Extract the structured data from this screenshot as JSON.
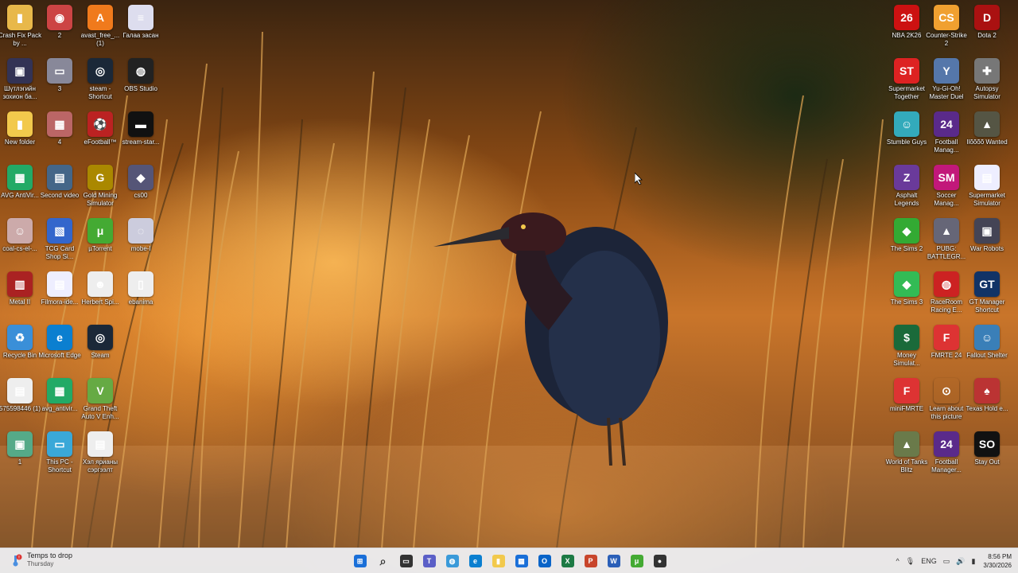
{
  "desktop": {
    "left_icons": [
      {
        "label": "Crash Fix Pack by ...",
        "color": "#e8b84a",
        "glyph": "▮"
      },
      {
        "label": "2",
        "color": "#c44",
        "glyph": "◉"
      },
      {
        "label": "avast_free_... (1)",
        "color": "#f07a1c",
        "glyph": "A"
      },
      {
        "label": "Галаа засан",
        "color": "#dde",
        "glyph": "≡"
      },
      {
        "label": "Шүтлэгийн зохион ба...",
        "color": "#335",
        "glyph": "▣"
      },
      {
        "label": "3",
        "color": "#889",
        "glyph": "▭"
      },
      {
        "label": "steam - Shortcut",
        "color": "#1b2838",
        "glyph": "◎"
      },
      {
        "label": "OBS Studio",
        "color": "#222",
        "glyph": "◍"
      },
      {
        "label": "New folder",
        "color": "#f2c94c",
        "glyph": "▮"
      },
      {
        "label": "4",
        "color": "#b66",
        "glyph": "▦"
      },
      {
        "label": "eFootball™",
        "color": "#b22",
        "glyph": "⚽"
      },
      {
        "label": "stream-star...",
        "color": "#111",
        "glyph": "▬"
      },
      {
        "label": "AVG AntiVir...",
        "color": "#2a6",
        "glyph": "▦"
      },
      {
        "label": "Second video",
        "color": "#468",
        "glyph": "▤"
      },
      {
        "label": "Gold Mining Simulator",
        "color": "#a80",
        "glyph": "G"
      },
      {
        "label": "cs00",
        "color": "#557",
        "glyph": "◆"
      },
      {
        "label": "coal-cs-el-...",
        "color": "#caa",
        "glyph": "☺"
      },
      {
        "label": "TCG Card Shop Si...",
        "color": "#36c",
        "glyph": "▧"
      },
      {
        "label": "µTorrent",
        "color": "#4a3",
        "glyph": "μ"
      },
      {
        "label": "mobe-l",
        "color": "#ccd",
        "glyph": "◌"
      },
      {
        "label": "Metal II",
        "color": "#a22",
        "glyph": "▥"
      },
      {
        "label": "Filmora-ide...",
        "color": "#eef",
        "glyph": "▤"
      },
      {
        "label": "Herbert Spi...",
        "color": "#eee",
        "glyph": "☻"
      },
      {
        "label": "ebanima",
        "color": "#eee",
        "glyph": "▯"
      },
      {
        "label": "Recycle Bin",
        "color": "#3a8fd8",
        "glyph": "♻"
      },
      {
        "label": "Microsoft Edge",
        "color": "#0b7fd0",
        "glyph": "e"
      },
      {
        "label": "Steam",
        "color": "#1b2838",
        "glyph": "◎"
      },
      {
        "label": "575598446 (1)",
        "color": "#eee",
        "glyph": "▤"
      },
      {
        "label": "avg_antivir...",
        "color": "#2a6",
        "glyph": "▦"
      },
      {
        "label": "Grand Theft Auto V Enh...",
        "color": "#6a4",
        "glyph": "V"
      },
      {
        "label": "1",
        "color": "#5a8",
        "glyph": "▣"
      },
      {
        "label": "This PC - Shortcut",
        "color": "#3aa8d8",
        "glyph": "▭"
      },
      {
        "label": "Хэл ярианы сэргээлт",
        "color": "#eee",
        "glyph": "▤"
      }
    ],
    "right_icons": [
      {
        "label": "NBA 2K26",
        "color": "#c11",
        "glyph": "26"
      },
      {
        "label": "Counter-Strike 2",
        "color": "#f0a030",
        "glyph": "CS"
      },
      {
        "label": "Dota 2",
        "color": "#a11",
        "glyph": "D"
      },
      {
        "label": "Supermarket Together",
        "color": "#d22",
        "glyph": "ST"
      },
      {
        "label": "Yu-Gi-Oh! Master Duel",
        "color": "#57a",
        "glyph": "Y"
      },
      {
        "label": "Autopsy Simulator",
        "color": "#777",
        "glyph": "✚"
      },
      {
        "label": "Stumble Guys",
        "color": "#3ab",
        "glyph": "☺"
      },
      {
        "label": "Football Manag...",
        "color": "#5a2a8a",
        "glyph": "24"
      },
      {
        "label": "Ilõõõõ Wanted",
        "color": "#554",
        "glyph": "▲"
      },
      {
        "label": "Asphalt Legends",
        "color": "#6a3a9a",
        "glyph": "Z"
      },
      {
        "label": "Soccer Manag...",
        "color": "#c2187a",
        "glyph": "SM"
      },
      {
        "label": "Supermarket Simulator",
        "color": "#eef",
        "glyph": "▤"
      },
      {
        "label": "The Sims 2",
        "color": "#3a3",
        "glyph": "◆"
      },
      {
        "label": "PUBG: BATTLEGR...",
        "color": "#667",
        "glyph": "▲"
      },
      {
        "label": "War Robots",
        "color": "#445",
        "glyph": "▣"
      },
      {
        "label": "The Sims 3",
        "color": "#3b5",
        "glyph": "◆"
      },
      {
        "label": "RaceRoom Racing E...",
        "color": "#c22",
        "glyph": "◍"
      },
      {
        "label": "GT Manager Shortcut",
        "color": "#136",
        "glyph": "GT"
      },
      {
        "label": "Money Simulat...",
        "color": "#1a6a3a",
        "glyph": "$"
      },
      {
        "label": "FMRTE 24",
        "color": "#d33",
        "glyph": "F"
      },
      {
        "label": "Fallout Shelter",
        "color": "#3a7fb8",
        "glyph": "☺"
      },
      {
        "label": "miniFMRTE",
        "color": "#d33",
        "glyph": "F"
      },
      {
        "label": "Learn about this picture",
        "color": "rgba(0,0,0,0)",
        "glyph": "⊙"
      },
      {
        "label": "Texas Hold e...",
        "color": "#b33",
        "glyph": "♠"
      },
      {
        "label": "World of Tanks Blitz",
        "color": "#6a7a4a",
        "glyph": "▲"
      },
      {
        "label": "Football Manager...",
        "color": "#5a2a8a",
        "glyph": "24"
      },
      {
        "label": "Stay Out",
        "color": "#111",
        "glyph": "SO"
      }
    ]
  },
  "taskbar": {
    "weather_line1": "Temps to drop",
    "weather_line2": "Thursday",
    "apps": [
      {
        "name": "start-button",
        "color": "#1a6fd8",
        "glyph": "⊞"
      },
      {
        "name": "search-button",
        "color": "rgba(0,0,0,0)",
        "glyph": "⌕"
      },
      {
        "name": "task-view-button",
        "color": "#333",
        "glyph": "▭"
      },
      {
        "name": "teams-button",
        "color": "#5b5fc7",
        "glyph": "T"
      },
      {
        "name": "copilot-button",
        "color": "#3a9ad9",
        "glyph": "◍"
      },
      {
        "name": "edge-button",
        "color": "#0b7fd0",
        "glyph": "e"
      },
      {
        "name": "file-explorer-button",
        "color": "#f2c94c",
        "glyph": "▮"
      },
      {
        "name": "store-button",
        "color": "#1a6fd8",
        "glyph": "▦"
      },
      {
        "name": "outlook-button",
        "color": "#0a64c8",
        "glyph": "O"
      },
      {
        "name": "excel-button",
        "color": "#1d7a44",
        "glyph": "X"
      },
      {
        "name": "powerpoint-button",
        "color": "#c8452b",
        "glyph": "P"
      },
      {
        "name": "word-button",
        "color": "#2b5fb8",
        "glyph": "W"
      },
      {
        "name": "utorrent-button",
        "color": "#4a3",
        "glyph": "μ"
      },
      {
        "name": "recorder-button",
        "color": "#333",
        "glyph": "●"
      }
    ],
    "tray": {
      "language": "ENG",
      "time": "8:56 PM",
      "date": "3/30/2026"
    }
  }
}
